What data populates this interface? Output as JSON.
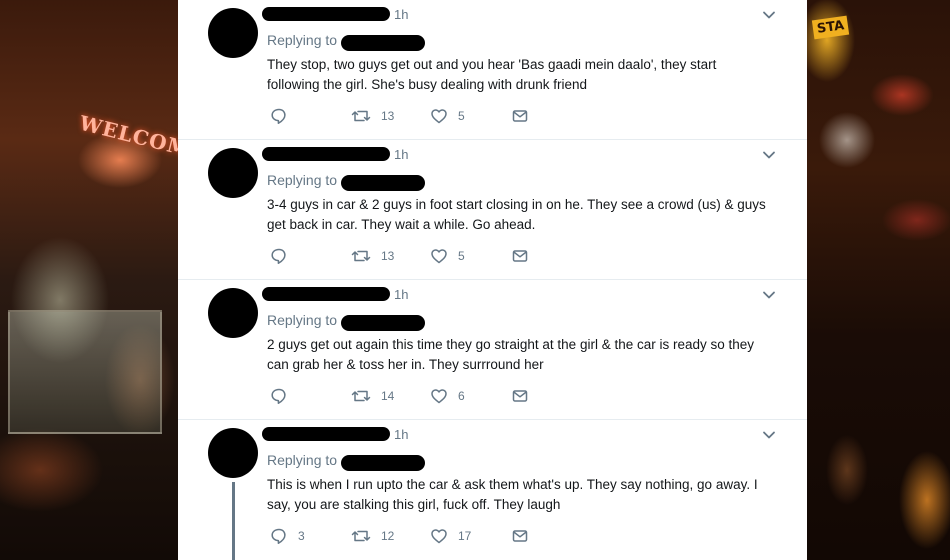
{
  "tweets": [
    {
      "time": "1h",
      "replying_label": "Replying to",
      "text": "They stop, two guys get out and you hear 'Bas gaadi mein daalo', they start following the girl. She's busy dealing with drunk friend",
      "replies": "",
      "retweets": "13",
      "likes": "5"
    },
    {
      "time": "1h",
      "replying_label": "Replying to",
      "text": "3-4 guys in car & 2 guys in foot start closing in on he. They see a crowd (us) & guys get back in car. They wait a while. Go ahead.",
      "replies": "",
      "retweets": "13",
      "likes": "5"
    },
    {
      "time": "1h",
      "replying_label": "Replying to",
      "text": "2 guys get out again this time they go straight at the girl & the car is ready so they can grab her & toss her in. They  surrround her",
      "replies": "",
      "retweets": "14",
      "likes": "6"
    },
    {
      "time": "1h",
      "replying_label": "Replying to",
      "text": "This is when I run upto the car & ask them what's up. They say nothing, go away. I say, you are stalking this girl, fuck off. They laugh",
      "replies": "3",
      "retweets": "12",
      "likes": "17"
    }
  ],
  "background": {
    "left_sign": "WELCOME",
    "right_sign": "STA"
  },
  "colors": {
    "text": "#14171a",
    "muted": "#657786",
    "divider": "#e6ecf0"
  },
  "icons": [
    "reply-icon",
    "retweet-icon",
    "like-icon",
    "message-icon",
    "chevron-down-icon"
  ]
}
